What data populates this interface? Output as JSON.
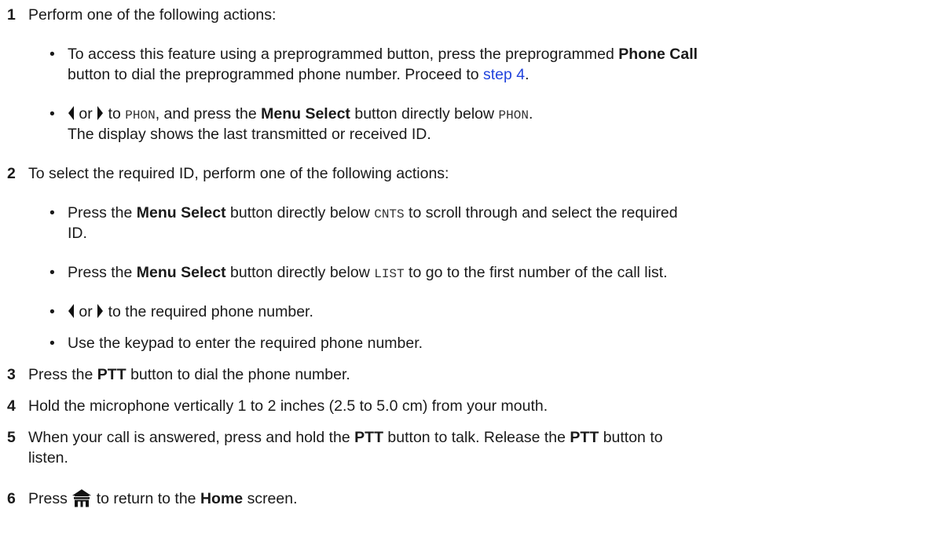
{
  "step1": {
    "number": "1",
    "text": "Perform one of the following actions:",
    "b1": {
      "line1_pre": "To access this feature using a preprogrammed button, press the preprogrammed",
      "line1_bold": "Phone Call",
      "line2_pre": "button to dial the preprogrammed phone number. Proceed to",
      "link": "step 4",
      "line2_post": "."
    },
    "b2": {
      "or": "or",
      "to": "to",
      "code1": "PHON",
      "mid": ", and press the",
      "bold": "Menu Select",
      "post": "button directly below",
      "code2": "PHON",
      "end": ".",
      "line2": "The display shows the last transmitted or received ID."
    }
  },
  "step2": {
    "number": "2",
    "text": "To select the required ID, perform one of the following actions:",
    "b1": {
      "pre": "Press the",
      "bold": "Menu Select",
      "mid": "button directly below",
      "code": "CNTS",
      "post": "to scroll through and select the required",
      "line2": "ID."
    },
    "b2": {
      "pre": "Press the",
      "bold": "Menu Select",
      "mid": "button directly below",
      "code": "LIST",
      "post": "to go to the first number of the call list."
    },
    "b3": {
      "or": "or",
      "post": "to the required phone number."
    },
    "b4": {
      "text": "Use the keypad to enter the required phone number."
    }
  },
  "step3": {
    "number": "3",
    "pre": "Press the",
    "bold": "PTT",
    "post": "button to dial the phone number."
  },
  "step4": {
    "number": "4",
    "text": "Hold the microphone vertically 1 to 2 inches (2.5 to 5.0 cm) from your mouth."
  },
  "step5": {
    "number": "5",
    "pre": "When your call is answered, press and hold the",
    "bold1": "PTT",
    "mid": "button to talk. Release the",
    "bold2": "PTT",
    "post": "button to",
    "line2": "listen."
  },
  "step6": {
    "number": "6",
    "pre": "Press",
    "mid": "to return to the",
    "bold": "Home",
    "post": "screen."
  },
  "bullet_char": "•",
  "icons": {
    "left_arrow": "left-arrow-icon",
    "right_arrow": "right-arrow-icon",
    "home": "home-icon"
  }
}
